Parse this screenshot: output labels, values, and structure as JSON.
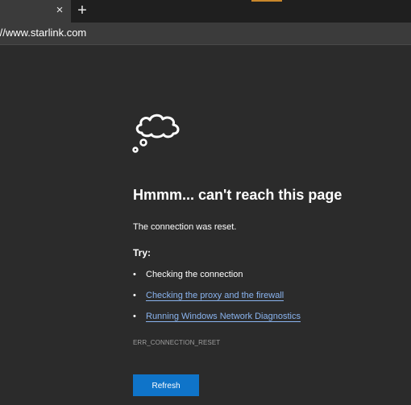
{
  "browser": {
    "tab_close_icon": "×",
    "new_tab_icon": "+",
    "address_bar": {
      "scheme": "://",
      "url": "www.starlink.com"
    }
  },
  "error_page": {
    "icon": "thought-cloud-icon",
    "heading": "Hmmm... can't reach this page",
    "message": "The connection was reset.",
    "try_label": "Try:",
    "suggestions": [
      {
        "bullet": "•",
        "label": "Checking the connection",
        "is_link": false
      },
      {
        "bullet": "•",
        "label": "Checking the proxy and the firewall",
        "is_link": true
      },
      {
        "bullet": "•",
        "label": "Running Windows Network Diagnostics",
        "is_link": true
      }
    ],
    "error_code": "ERR_CONNECTION_RESET",
    "refresh_label": "Refresh"
  },
  "colors": {
    "page_background": "#2b2b2b",
    "link": "#8ab4ef",
    "button": "#0f74c9",
    "tab_accent": "#c8872b"
  }
}
